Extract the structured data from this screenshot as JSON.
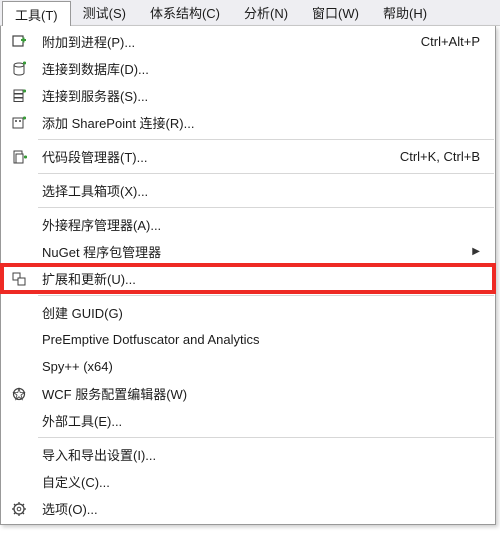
{
  "menubar": [
    {
      "label": "工具(T)",
      "active": true
    },
    {
      "label": "测试(S)"
    },
    {
      "label": "体系结构(C)"
    },
    {
      "label": "分析(N)"
    },
    {
      "label": "窗口(W)"
    },
    {
      "label": "帮助(H)"
    }
  ],
  "menu": [
    {
      "icon": "attach",
      "label": "附加到进程(P)...",
      "shortcut": "Ctrl+Alt+P"
    },
    {
      "icon": "db",
      "label": "连接到数据库(D)..."
    },
    {
      "icon": "server",
      "label": "连接到服务器(S)..."
    },
    {
      "icon": "sharepoint",
      "label": "添加 SharePoint 连接(R)..."
    },
    {
      "separator": true
    },
    {
      "icon": "snippet",
      "label": "代码段管理器(T)...",
      "shortcut": "Ctrl+K, Ctrl+B"
    },
    {
      "separator": true
    },
    {
      "icon": "",
      "label": "选择工具箱项(X)..."
    },
    {
      "separator": true
    },
    {
      "icon": "",
      "label": "外接程序管理器(A)..."
    },
    {
      "icon": "",
      "label": "NuGet 程序包管理器",
      "submenu": true
    },
    {
      "icon": "extend",
      "label": "扩展和更新(U)...",
      "highlight": true
    },
    {
      "separator": true
    },
    {
      "icon": "",
      "label": "创建 GUID(G)"
    },
    {
      "icon": "",
      "label": "PreEmptive Dotfuscator and Analytics"
    },
    {
      "icon": "",
      "label": "Spy++ (x64)"
    },
    {
      "icon": "wcf",
      "label": "WCF 服务配置编辑器(W)"
    },
    {
      "icon": "",
      "label": "外部工具(E)..."
    },
    {
      "separator": true
    },
    {
      "icon": "",
      "label": "导入和导出设置(I)..."
    },
    {
      "icon": "",
      "label": "自定义(C)..."
    },
    {
      "icon": "options",
      "label": "选项(O)..."
    }
  ]
}
